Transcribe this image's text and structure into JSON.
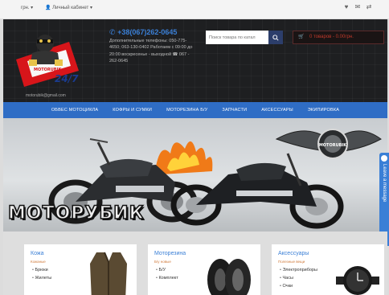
{
  "topbar": {
    "lang": "грн.",
    "cabinet": "Личный кабинет",
    "icons": [
      "heart-icon",
      "mail-icon",
      "compare-icon"
    ]
  },
  "header": {
    "logo_text": "MOTORUBIK",
    "email": "motorubik@gmail.com",
    "main_phone": "+38(067)262-0645",
    "contacts_text": "Дополнительные телефоны: 050-775-4650; 063-130-0402 Работаем с 09:00 до 20:00 воскресенье - выходной ☎ 067 - 262-0645",
    "search_placeholder": "Поиск товара по катал",
    "cart_label": "0 товаров - 0.00грн."
  },
  "nav": {
    "items": [
      "ОБВЕС МОТОЦИКЛА",
      "КОФРЫ И СУМКИ",
      "МОТОРЕЗИНА Б/У",
      "ЗАПЧАСТИ",
      "АКСЕССУАРЫ",
      "ЭКИПИРОВКА"
    ]
  },
  "hero": {
    "title": "МОТОРУБИК",
    "badge_text": "MOTORUBIK"
  },
  "side_tab": {
    "label": "Leave a message"
  },
  "cards": [
    {
      "title": "Кожа",
      "sub": "Кожаные",
      "items": [
        "Брюки",
        "Жилеты"
      ]
    },
    {
      "title": "Моторезина",
      "sub": "Б/у новые",
      "items": [
        "Б/У",
        "Комплект"
      ]
    },
    {
      "title": "Аксессуары",
      "sub": "Полезные вещи",
      "items": [
        "Электроприборы",
        "Часы",
        "Очки"
      ]
    }
  ],
  "colors": {
    "nav_blue": "#2f6dc5",
    "accent_blue": "#3a7fd6",
    "header_dark": "#1e1f21",
    "cart_red": "#c0392b"
  }
}
